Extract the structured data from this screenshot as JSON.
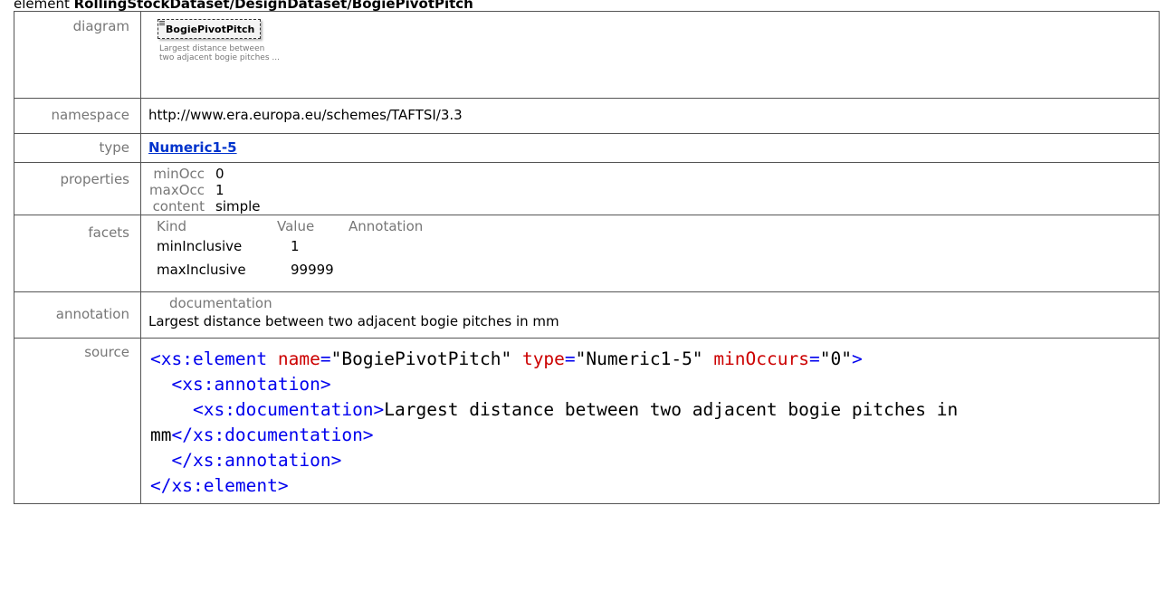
{
  "heading": {
    "prefix": "element ",
    "path": "RollingStockDataset/DesignDataset/BogiePivotPitch"
  },
  "labels": {
    "diagram": "diagram",
    "namespace": "namespace",
    "type": "type",
    "properties": "properties",
    "facets": "facets",
    "annotation": "annotation",
    "source": "source"
  },
  "diagram": {
    "element_name": "BogiePivotPitch",
    "description_line1": "Largest distance between",
    "description_line2": "two adjacent bogie pitches ..."
  },
  "namespace": "http://www.era.europa.eu/schemes/TAFTSI/3.3",
  "type": "Numeric1-5",
  "properties": [
    {
      "key": "minOcc",
      "value": "0"
    },
    {
      "key": "maxOcc",
      "value": "1"
    },
    {
      "key": "content",
      "value": "simple"
    }
  ],
  "facets": {
    "headers": [
      "Kind",
      "Value",
      "Annotation"
    ],
    "rows": [
      {
        "kind": "minInclusive",
        "value": "1"
      },
      {
        "kind": "maxInclusive",
        "value": "99999"
      }
    ]
  },
  "annotation": {
    "header": "documentation",
    "text": "Largest distance between two adjacent bogie pitches in mm"
  },
  "source": {
    "line1": {
      "open": "<xs:element",
      "attr1": "name",
      "val1": "\"BogiePivotPitch\"",
      "attr2": "type",
      "val2": "\"Numeric1-5\"",
      "attr3": "minOccurs",
      "val3": "\"0\"",
      "close": ">"
    },
    "line2": "<xs:annotation>",
    "line3_open": "<xs:documentation>",
    "line3_text": "Largest distance between two adjacent bogie pitches in",
    "line4_text": "mm",
    "line4_close": "</xs:documentation>",
    "line5": "</xs:annotation>",
    "line6": "</xs:element>"
  }
}
